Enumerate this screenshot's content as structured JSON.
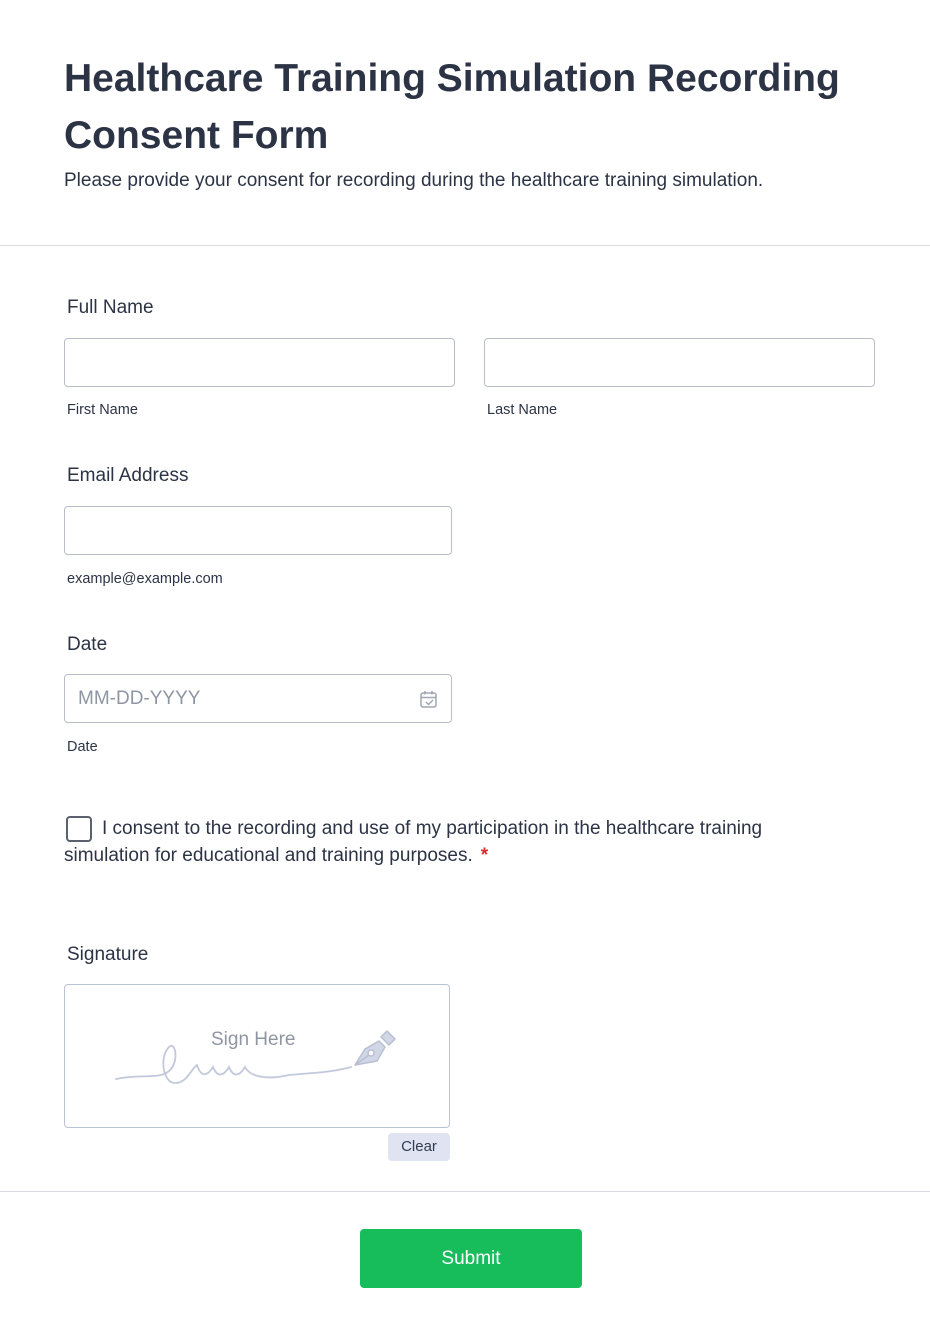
{
  "header": {
    "title": "Healthcare Training Simulation Recording Consent Form",
    "subtitle": "Please provide your consent for recording during the healthcare training simulation."
  },
  "full_name": {
    "label": "Full Name",
    "first": {
      "value": "",
      "sublabel": "First Name"
    },
    "last": {
      "value": "",
      "sublabel": "Last Name"
    }
  },
  "email": {
    "label": "Email Address",
    "value": "",
    "sublabel": "example@example.com"
  },
  "date": {
    "label": "Date",
    "value": "",
    "placeholder": "MM-DD-YYYY",
    "sublabel": "Date",
    "icon": "calendar-icon"
  },
  "consent": {
    "checked": false,
    "text": "I consent to the recording and use of my participation in the healthcare training simulation for educational and training purposes.",
    "required_mark": "*"
  },
  "signature": {
    "label": "Signature",
    "hint": "Sign Here",
    "icon": "pen-nib-icon",
    "clear_label": "Clear"
  },
  "submit": {
    "label": "Submit"
  },
  "colors": {
    "submit_bg": "#18bd5b",
    "required": "#e02a2a",
    "text": "#2c3345",
    "clear_bg": "#dfe3f2"
  }
}
